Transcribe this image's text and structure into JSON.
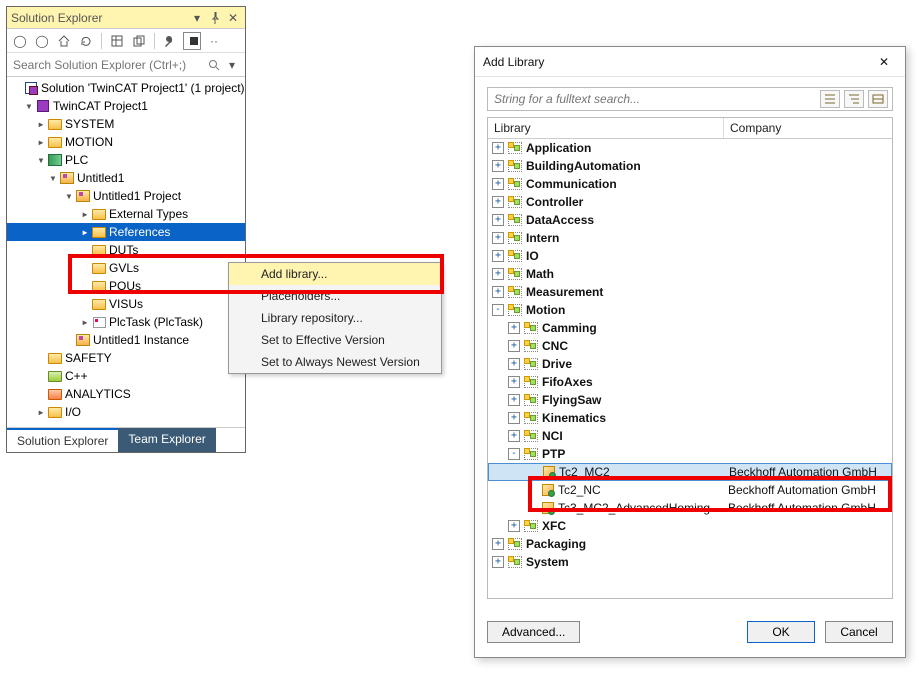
{
  "sol": {
    "title": "Solution Explorer",
    "search_placeholder": "Search Solution Explorer (Ctrl+;)",
    "tree": {
      "solution": "Solution 'TwinCAT Project1' (1 project)",
      "project": "TwinCAT Project1",
      "system": "SYSTEM",
      "motion": "MOTION",
      "plc": "PLC",
      "plc_proj": "Untitled1",
      "plc_proj_inner": "Untitled1 Project",
      "ext_types": "External Types",
      "references": "References",
      "duts": "DUTs",
      "gvls": "GVLs",
      "pous": "POUs",
      "visus": "VISUs",
      "plctask": "PlcTask (PlcTask)",
      "instance": "Untitled1 Instance",
      "safety": "SAFETY",
      "cpp": "C++",
      "analytics": "ANALYTICS",
      "io": "I/O"
    },
    "tabs": {
      "active": "Solution Explorer",
      "other": "Team Explorer"
    }
  },
  "ctx": {
    "add_library": "Add library...",
    "placeholders": "Placeholders...",
    "lib_repo": "Library repository...",
    "eff_ver": "Set to Effective Version",
    "newest": "Set to Always Newest Version"
  },
  "dlg": {
    "title": "Add Library",
    "search_placeholder": "String for a fulltext search...",
    "col_lib": "Library",
    "col_co": "Company",
    "cats": {
      "application": "Application",
      "building": "BuildingAutomation",
      "comm": "Communication",
      "controller": "Controller",
      "dataaccess": "DataAccess",
      "intern": "Intern",
      "io": "IO",
      "math": "Math",
      "measurement": "Measurement",
      "motion": "Motion",
      "camming": "Camming",
      "cnc": "CNC",
      "drive": "Drive",
      "fifoaxes": "FifoAxes",
      "flyingsaw": "FlyingSaw",
      "kinematics": "Kinematics",
      "nci": "NCI",
      "ptp": "PTP",
      "xfc": "XFC",
      "packaging": "Packaging",
      "system": "System"
    },
    "libs": {
      "tc2mc2": {
        "name": "Tc2_MC2",
        "co": "Beckhoff Automation GmbH"
      },
      "tc2nc": {
        "name": "Tc2_NC",
        "co": "Beckhoff Automation GmbH"
      },
      "tc3adv": {
        "name": "Tc3_MC2_AdvancedHoming",
        "co": "Beckhoff Automation GmbH"
      }
    },
    "advanced": "Advanced...",
    "ok": "OK",
    "cancel": "Cancel"
  }
}
